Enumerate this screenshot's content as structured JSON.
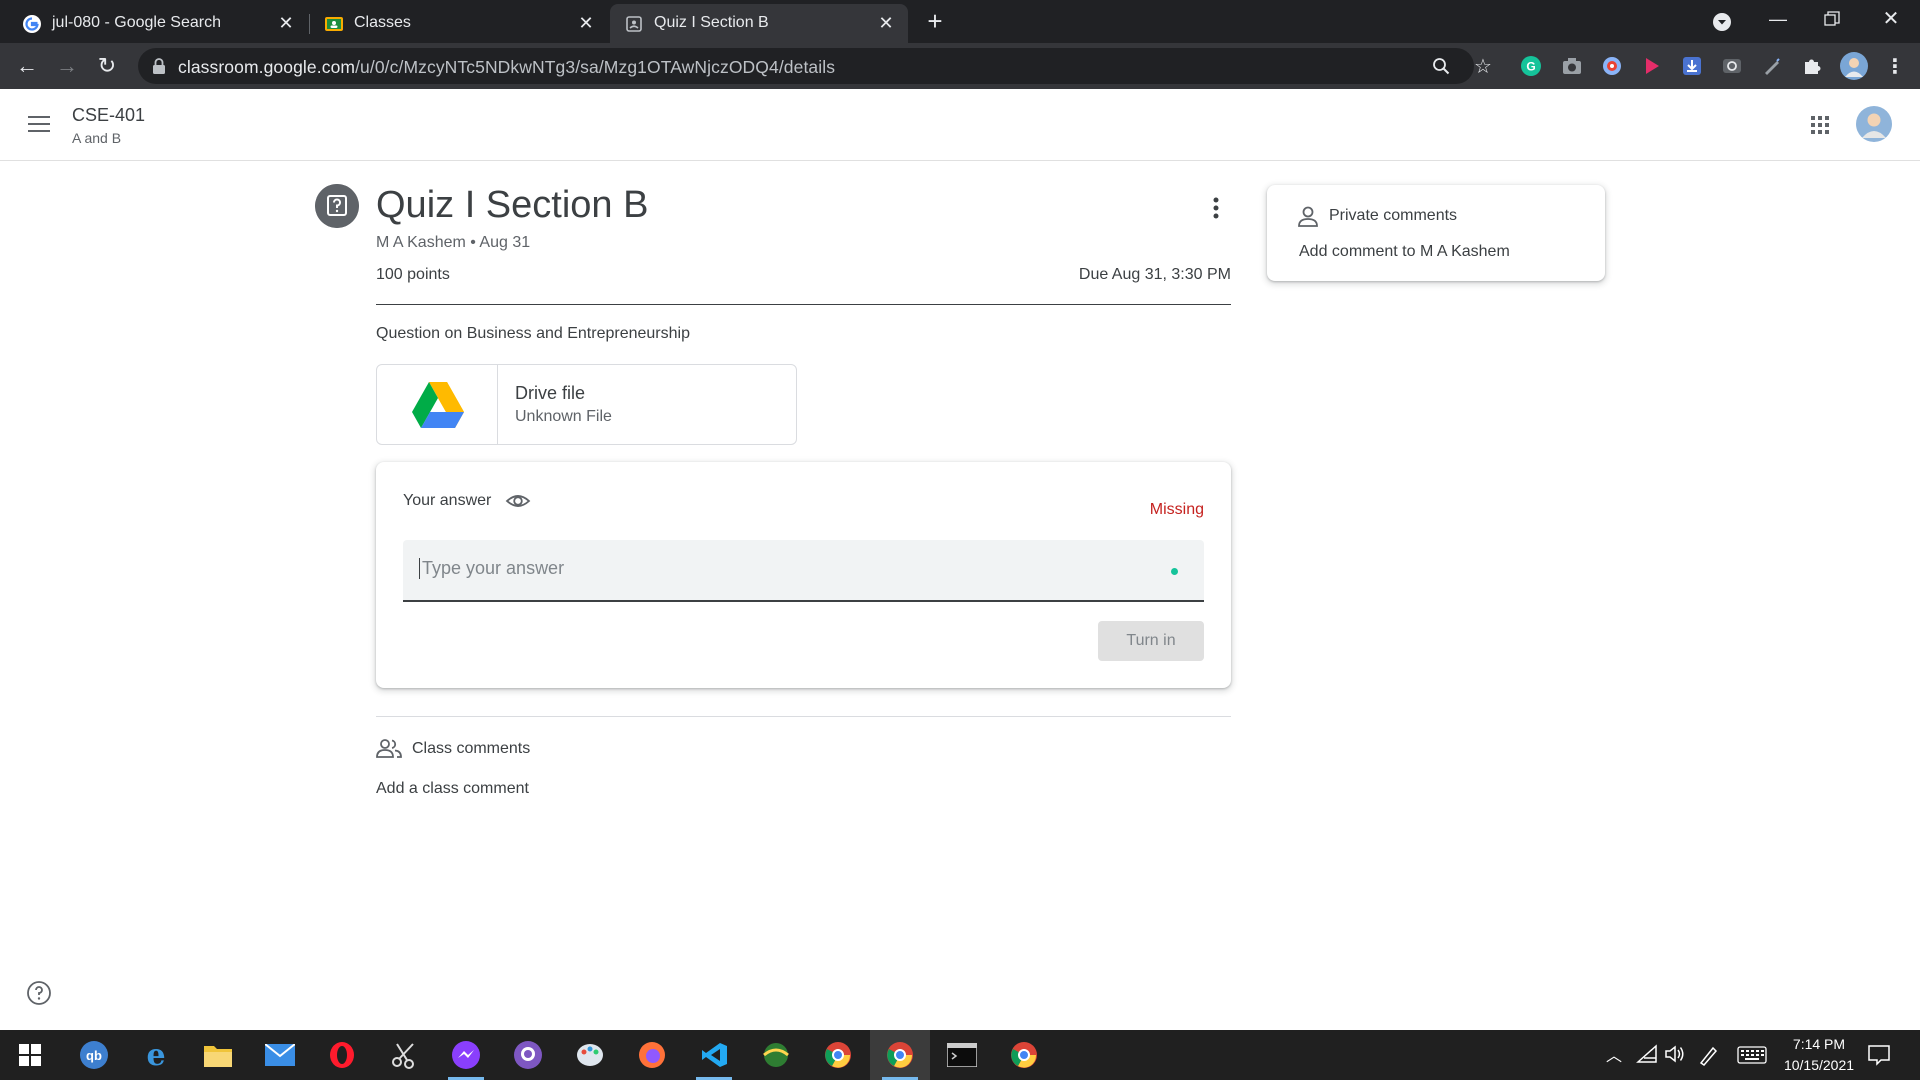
{
  "browser": {
    "tabs": [
      {
        "title": "jul-080 - Google Search",
        "icon": "google-g-icon",
        "active": false
      },
      {
        "title": "Classes",
        "icon": "classroom-icon",
        "active": false
      },
      {
        "title": "Quiz I Section B",
        "icon": "assignment-icon",
        "active": true
      }
    ],
    "url_host": "classroom.google.com",
    "url_path": "/u/0/c/MzcyNTc5NDkwNTg3/sa/Mzg1OTAwNjczODQ4/details"
  },
  "header": {
    "class_name": "CSE-401",
    "class_section": "A and B"
  },
  "assignment": {
    "title": "Quiz I Section B",
    "meta": "M A Kashem • Aug 31",
    "points": "100 points",
    "due": "Due Aug 31, 3:30 PM",
    "description": "Question on Business and Entrepreneurship",
    "attachment": {
      "title": "Drive file",
      "subtitle": "Unknown File",
      "icon": "google-drive-icon"
    }
  },
  "answer": {
    "label": "Your answer",
    "status": "Missing",
    "placeholder": "Type your answer",
    "turn_in_label": "Turn in"
  },
  "class_comments": {
    "label": "Class comments",
    "add_label": "Add a class comment"
  },
  "private_comments": {
    "label": "Private comments",
    "add_label": "Add comment to M A Kashem"
  },
  "taskbar": {
    "time": "7:14 PM",
    "date": "10/15/2021"
  },
  "colors": {
    "status_missing": "#c5221f",
    "chrome_bg": "#202124",
    "toolbar_bg": "#35363a"
  }
}
